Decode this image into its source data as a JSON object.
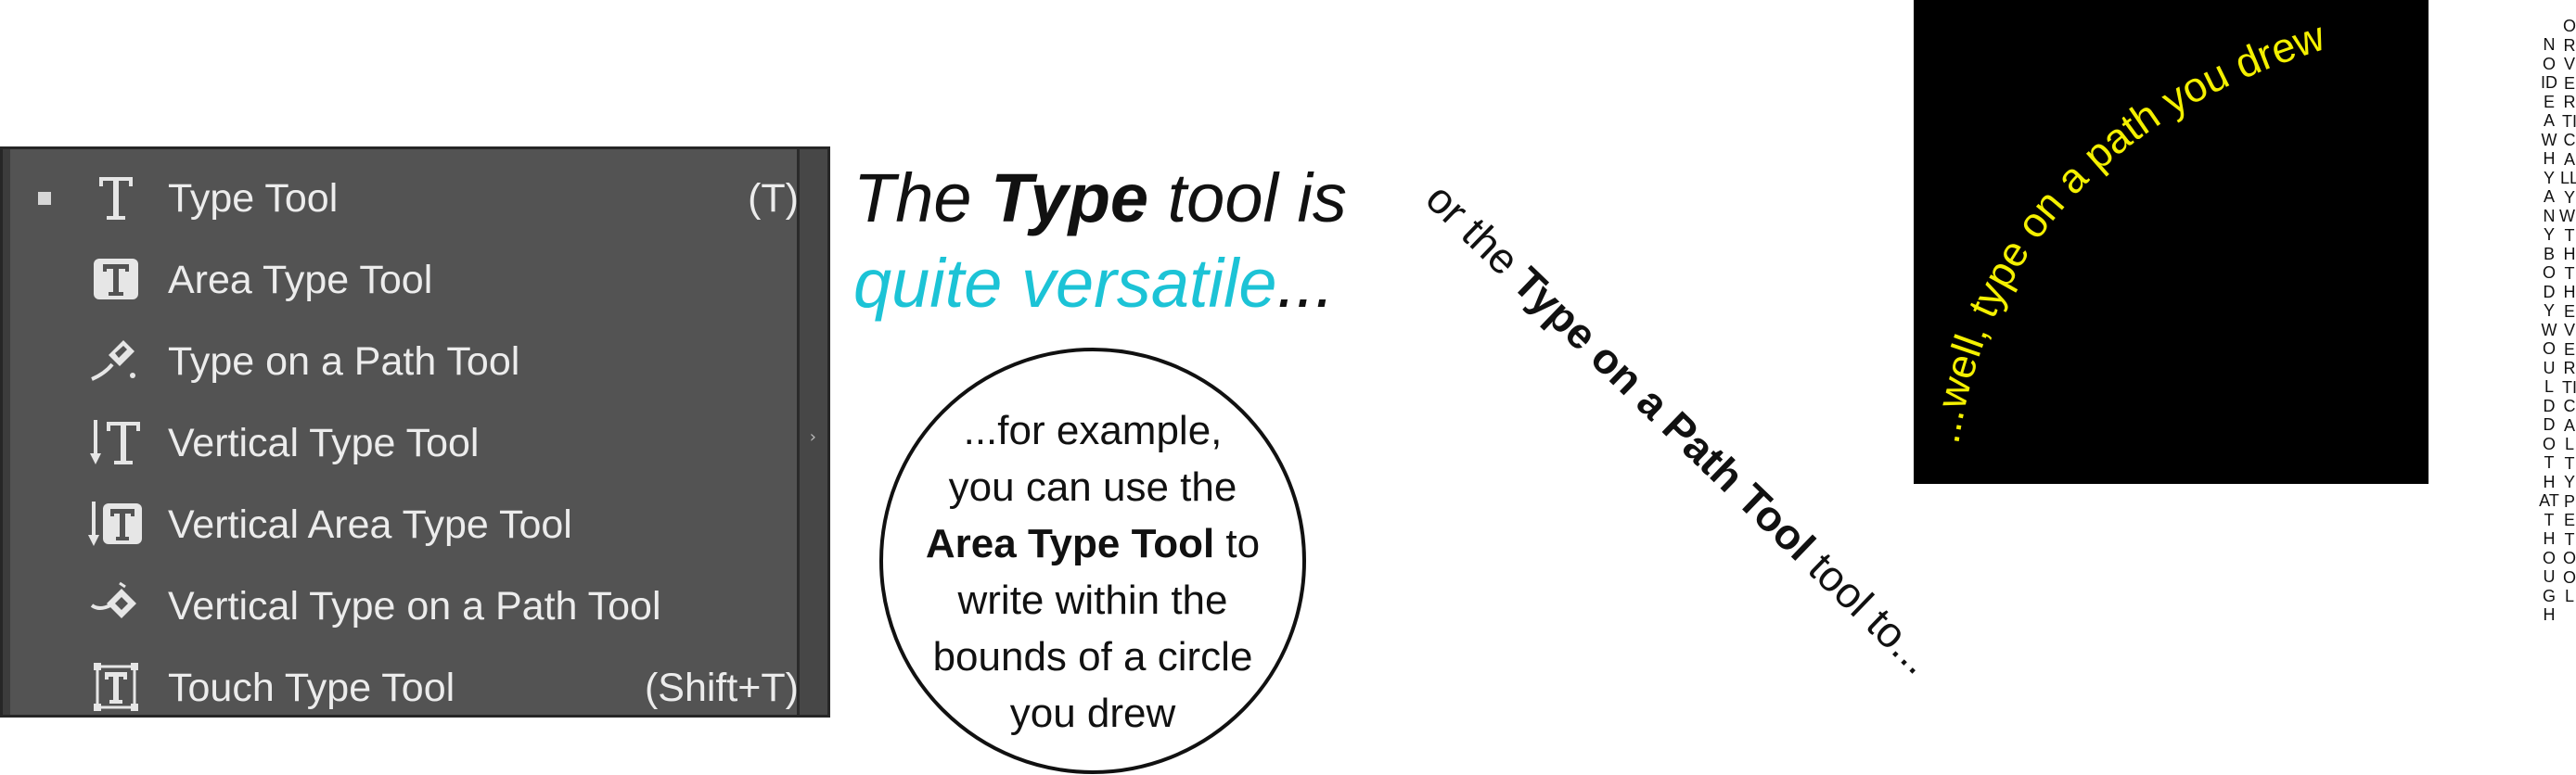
{
  "menu": {
    "items": [
      {
        "label": "Type Tool",
        "shortcut": "(T)",
        "icon": "type-tool-icon",
        "selected": true
      },
      {
        "label": "Area Type Tool",
        "shortcut": "",
        "icon": "area-type-tool-icon",
        "selected": false
      },
      {
        "label": "Type on a Path Tool",
        "shortcut": "",
        "icon": "type-on-path-tool-icon",
        "selected": false
      },
      {
        "label": "Vertical Type Tool",
        "shortcut": "",
        "icon": "vertical-type-tool-icon",
        "selected": false
      },
      {
        "label": "Vertical Area Type Tool",
        "shortcut": "",
        "icon": "vertical-area-type-tool-icon",
        "selected": false
      },
      {
        "label": "Vertical Type on a Path Tool",
        "shortcut": "",
        "icon": "vertical-type-on-path-tool-icon",
        "selected": false
      },
      {
        "label": "Touch Type Tool",
        "shortcut": "(Shift+T)",
        "icon": "touch-type-tool-icon",
        "selected": false
      }
    ],
    "submenu_arrow": "›"
  },
  "headline": {
    "line1_pre": "The ",
    "line1_bold": "Type",
    "line1_post": " tool is",
    "line2_accent": "quite versatile",
    "line2_post": "..."
  },
  "circle": {
    "line1": "...for example,",
    "line2": "you can use the",
    "line3_bold": "Area Type Tool",
    "line3_post": " to",
    "line4": "write within the",
    "line5": "bounds of a circle",
    "line6": "you drew"
  },
  "diagonal": {
    "pre": "or the ",
    "bold": "Type on a Path Tool",
    "post": " tool to..."
  },
  "curved": {
    "text": "...well, type on a path you drew"
  },
  "vertical": {
    "column_a": "NO IDEA WHY ANYBODY WOULD DO THAT THOUGH",
    "column_b": "OR VERTICALLY WITH THE VERTICAL TYPE TOOL"
  },
  "colors": {
    "menu_bg": "#535353",
    "accent_cyan": "#1cc3d6",
    "curved_yellow": "#f4f000"
  }
}
